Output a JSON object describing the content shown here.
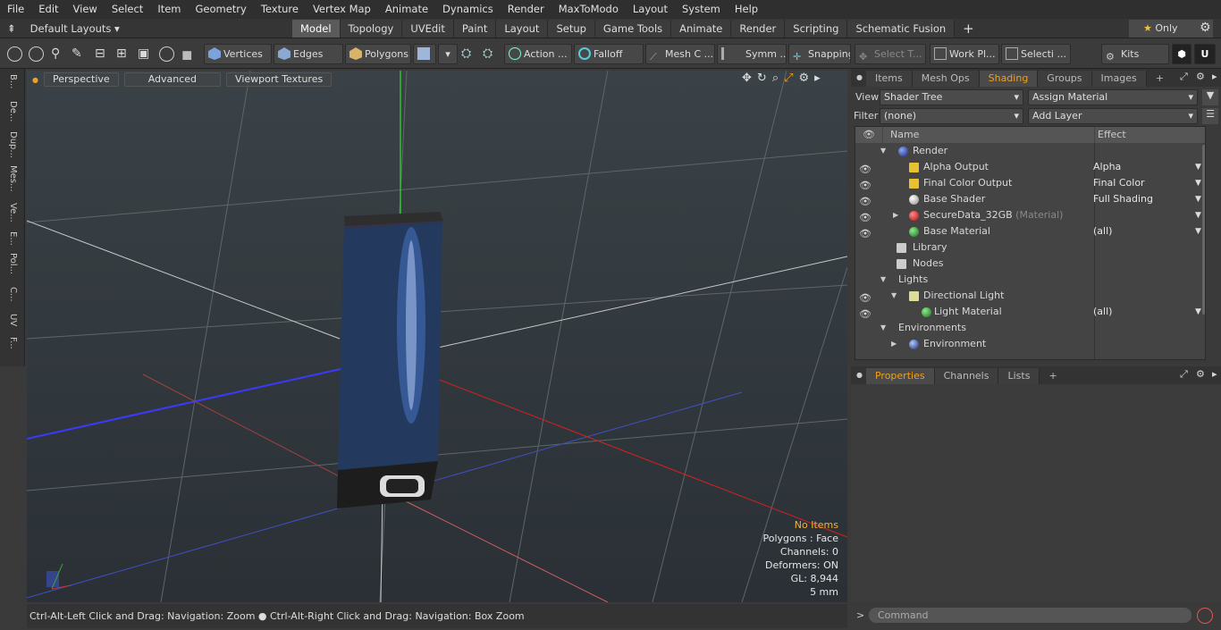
{
  "menu": [
    "File",
    "Edit",
    "View",
    "Select",
    "Item",
    "Geometry",
    "Texture",
    "Vertex Map",
    "Animate",
    "Dynamics",
    "Render",
    "MaxToModo",
    "Layout",
    "System",
    "Help"
  ],
  "layout_selector": "Default Layouts",
  "mode_tabs": [
    "Model",
    "Topology",
    "UVEdit",
    "Paint",
    "Layout",
    "Setup",
    "Game Tools",
    "Animate",
    "Render",
    "Scripting",
    "Schematic Fusion"
  ],
  "active_mode_tab": "Model",
  "only_label": "Only",
  "toolbar": {
    "vertices": "Vertices",
    "edges": "Edges",
    "polygons": "Polygons",
    "action": "Action ...",
    "falloff": "Falloff",
    "mesh": "Mesh C ...",
    "symm": "Symm ...",
    "snapping": "Snapping",
    "select_t": "Select T...",
    "work_pl": "Work Pl...",
    "selecti": "Selecti ...",
    "kits": "Kits"
  },
  "left_tabs": [
    "B...",
    "De...",
    "Dup...",
    "Mes...",
    "Ve...",
    "E...",
    "Pol...",
    "C...",
    "UV",
    "F..."
  ],
  "viewport": {
    "buttons": [
      "Perspective",
      "Advanced",
      "Viewport Textures"
    ],
    "info": [
      "No Items",
      "Polygons : Face",
      "Channels: 0",
      "Deformers: ON",
      "GL: 8,944",
      "5 mm"
    ]
  },
  "status_text": "Ctrl-Alt-Left Click and Drag: Navigation: Zoom ● Ctrl-Alt-Right Click and Drag: Navigation: Box Zoom",
  "panel": {
    "tabs": [
      "Items",
      "Mesh Ops",
      "Shading",
      "Groups",
      "Images"
    ],
    "active_tab": "Shading",
    "view_label": "View",
    "view_value": "Shader Tree",
    "assign_material": "Assign Material",
    "filter_label": "Filter",
    "filter_value": "(none)",
    "add_layer": "Add Layer",
    "col_name": "Name",
    "col_effect": "Effect",
    "rows": [
      {
        "name": "Render",
        "effect": "",
        "note": ""
      },
      {
        "name": "Alpha Output",
        "effect": "Alpha",
        "note": ""
      },
      {
        "name": "Final Color Output",
        "effect": "Final Color",
        "note": ""
      },
      {
        "name": "Base Shader",
        "effect": "Full Shading",
        "note": ""
      },
      {
        "name": "SecureData_32GB",
        "effect": "",
        "note": "(Material)"
      },
      {
        "name": "Base Material",
        "effect": "(all)",
        "note": ""
      },
      {
        "name": "Library",
        "effect": "",
        "note": ""
      },
      {
        "name": "Nodes",
        "effect": "",
        "note": ""
      },
      {
        "name": "Lights",
        "effect": "",
        "note": ""
      },
      {
        "name": "Directional Light",
        "effect": "",
        "note": ""
      },
      {
        "name": "Light Material",
        "effect": "(all)",
        "note": ""
      },
      {
        "name": "Environments",
        "effect": "",
        "note": ""
      },
      {
        "name": "Environment",
        "effect": "",
        "note": ""
      }
    ]
  },
  "props_panel": {
    "tabs": [
      "Properties",
      "Channels",
      "Lists"
    ],
    "active_tab": "Properties"
  },
  "command_placeholder": "Command",
  "colors": {
    "accent": "#f0a020",
    "viewport_bg": "#343b40"
  }
}
